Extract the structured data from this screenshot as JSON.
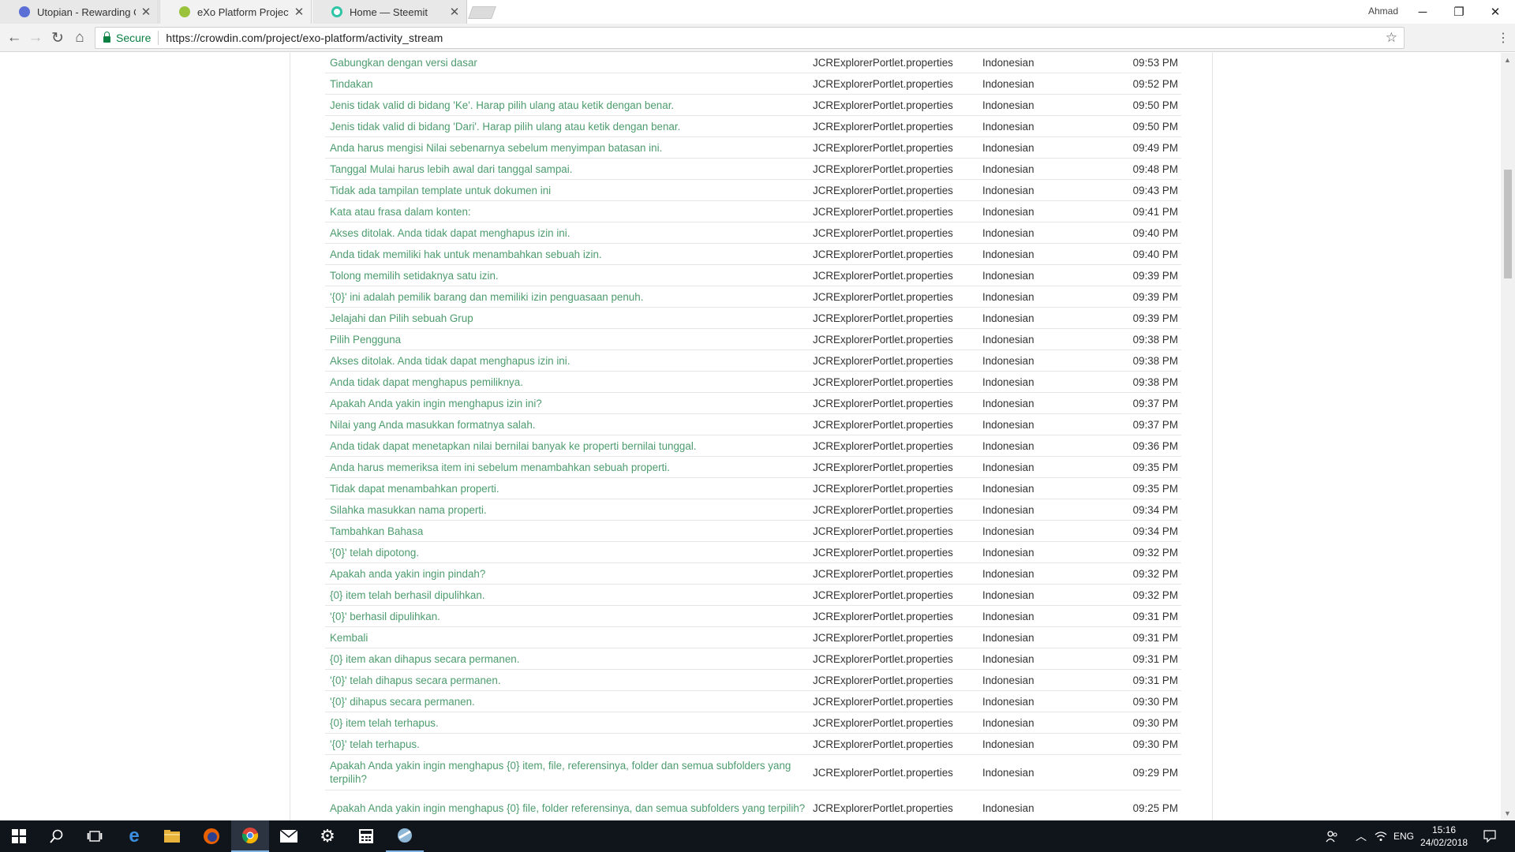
{
  "browser": {
    "tabs": [
      {
        "title": "Utopian - Rewarding Op",
        "active": false,
        "favicon_color": "#5b6fd6"
      },
      {
        "title": "eXo Platform Project Act",
        "active": true,
        "favicon_color": "#9ac33b"
      },
      {
        "title": "Home — Steemit",
        "active": false,
        "favicon_color": "#2ec4a6"
      }
    ],
    "profile_name": "Ahmad",
    "secure_label": "Secure",
    "url": "https://crowdin.com/project/exo-platform/activity_stream"
  },
  "activity": {
    "rows": [
      {
        "text": "Gabungkan dengan versi dasar",
        "file": "JCRExplorerPortlet.properties",
        "language": "Indonesian",
        "time": "09:53 PM"
      },
      {
        "text": "Tindakan",
        "file": "JCRExplorerPortlet.properties",
        "language": "Indonesian",
        "time": "09:52 PM"
      },
      {
        "text": "Jenis tidak valid di bidang 'Ke'. Harap pilih ulang atau ketik dengan benar.",
        "file": "JCRExplorerPortlet.properties",
        "language": "Indonesian",
        "time": "09:50 PM"
      },
      {
        "text": "Jenis tidak valid di bidang 'Dari'. Harap pilih ulang atau ketik dengan benar.",
        "file": "JCRExplorerPortlet.properties",
        "language": "Indonesian",
        "time": "09:50 PM"
      },
      {
        "text": "Anda harus mengisi Nilai sebenarnya sebelum menyimpan batasan ini.",
        "file": "JCRExplorerPortlet.properties",
        "language": "Indonesian",
        "time": "09:49 PM"
      },
      {
        "text": "Tanggal Mulai harus lebih awal dari tanggal sampai.",
        "file": "JCRExplorerPortlet.properties",
        "language": "Indonesian",
        "time": "09:48 PM"
      },
      {
        "text": "Tidak ada tampilan template untuk dokumen ini",
        "file": "JCRExplorerPortlet.properties",
        "language": "Indonesian",
        "time": "09:43 PM"
      },
      {
        "text": "Kata atau frasa dalam konten:",
        "file": "JCRExplorerPortlet.properties",
        "language": "Indonesian",
        "time": "09:41 PM"
      },
      {
        "text": "Akses ditolak. Anda tidak dapat menghapus izin ini.",
        "file": "JCRExplorerPortlet.properties",
        "language": "Indonesian",
        "time": "09:40 PM"
      },
      {
        "text": "Anda tidak memiliki hak untuk menambahkan sebuah izin.",
        "file": "JCRExplorerPortlet.properties",
        "language": "Indonesian",
        "time": "09:40 PM"
      },
      {
        "text": "Tolong memilih setidaknya satu izin.",
        "file": "JCRExplorerPortlet.properties",
        "language": "Indonesian",
        "time": "09:39 PM"
      },
      {
        "text": "'{0}' ini adalah pemilik barang dan memiliki izin penguasaan penuh.",
        "file": "JCRExplorerPortlet.properties",
        "language": "Indonesian",
        "time": "09:39 PM"
      },
      {
        "text": "Jelajahi dan Pilih sebuah Grup",
        "file": "JCRExplorerPortlet.properties",
        "language": "Indonesian",
        "time": "09:39 PM"
      },
      {
        "text": "Pilih Pengguna",
        "file": "JCRExplorerPortlet.properties",
        "language": "Indonesian",
        "time": "09:38 PM"
      },
      {
        "text": "Akses ditolak. Anda tidak dapat menghapus izin ini.",
        "file": "JCRExplorerPortlet.properties",
        "language": "Indonesian",
        "time": "09:38 PM"
      },
      {
        "text": "Anda tidak dapat menghapus pemiliknya.",
        "file": "JCRExplorerPortlet.properties",
        "language": "Indonesian",
        "time": "09:38 PM"
      },
      {
        "text": "Apakah Anda yakin ingin menghapus izin ini?",
        "file": "JCRExplorerPortlet.properties",
        "language": "Indonesian",
        "time": "09:37 PM"
      },
      {
        "text": "Nilai yang Anda masukkan formatnya salah.",
        "file": "JCRExplorerPortlet.properties",
        "language": "Indonesian",
        "time": "09:37 PM"
      },
      {
        "text": "Anda tidak dapat menetapkan nilai bernilai banyak ke properti bernilai tunggal.",
        "file": "JCRExplorerPortlet.properties",
        "language": "Indonesian",
        "time": "09:36 PM"
      },
      {
        "text": "Anda harus memeriksa item ini sebelum menambahkan sebuah properti.",
        "file": "JCRExplorerPortlet.properties",
        "language": "Indonesian",
        "time": "09:35 PM"
      },
      {
        "text": "Tidak dapat menambahkan properti.",
        "file": "JCRExplorerPortlet.properties",
        "language": "Indonesian",
        "time": "09:35 PM"
      },
      {
        "text": "Silahka masukkan nama properti.",
        "file": "JCRExplorerPortlet.properties",
        "language": "Indonesian",
        "time": "09:34 PM"
      },
      {
        "text": "Tambahkan Bahasa",
        "file": "JCRExplorerPortlet.properties",
        "language": "Indonesian",
        "time": "09:34 PM"
      },
      {
        "text": "'{0}' telah dipotong.",
        "file": "JCRExplorerPortlet.properties",
        "language": "Indonesian",
        "time": "09:32 PM"
      },
      {
        "text": "Apakah anda yakin ingin pindah?",
        "file": "JCRExplorerPortlet.properties",
        "language": "Indonesian",
        "time": "09:32 PM"
      },
      {
        "text": "{0} item telah berhasil dipulihkan.",
        "file": "JCRExplorerPortlet.properties",
        "language": "Indonesian",
        "time": "09:32 PM"
      },
      {
        "text": "'{0}' berhasil dipulihkan.",
        "file": "JCRExplorerPortlet.properties",
        "language": "Indonesian",
        "time": "09:31 PM"
      },
      {
        "text": "Kembali",
        "file": "JCRExplorerPortlet.properties",
        "language": "Indonesian",
        "time": "09:31 PM"
      },
      {
        "text": "{0} item akan dihapus secara permanen.",
        "file": "JCRExplorerPortlet.properties",
        "language": "Indonesian",
        "time": "09:31 PM"
      },
      {
        "text": "'{0}' telah dihapus secara permanen.",
        "file": "JCRExplorerPortlet.properties",
        "language": "Indonesian",
        "time": "09:31 PM"
      },
      {
        "text": "'{0}' dihapus secara permanen.",
        "file": "JCRExplorerPortlet.properties",
        "language": "Indonesian",
        "time": "09:30 PM"
      },
      {
        "text": "{0} item telah terhapus.",
        "file": "JCRExplorerPortlet.properties",
        "language": "Indonesian",
        "time": "09:30 PM"
      },
      {
        "text": "'{0}' telah terhapus.",
        "file": "JCRExplorerPortlet.properties",
        "language": "Indonesian",
        "time": "09:30 PM"
      },
      {
        "text": "Apakah Anda yakin ingin menghapus {0} item, file, referensinya, folder dan semua subfolders yang terpilih?",
        "file": "JCRExplorerPortlet.properties",
        "language": "Indonesian",
        "time": "09:29 PM"
      },
      {
        "text": "Apakah Anda yakin ingin menghapus {0} file, folder referensinya, dan semua subfolders yang terpilih?",
        "file": "JCRExplorerPortlet.properties",
        "language": "Indonesian",
        "time": "09:25 PM"
      }
    ]
  },
  "taskbar": {
    "language": "ENG",
    "time": "15:16",
    "date": "24/02/2018"
  }
}
